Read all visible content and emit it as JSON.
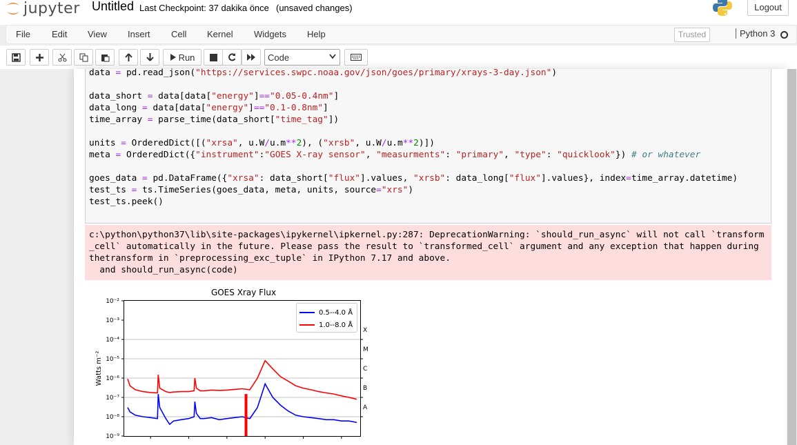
{
  "header": {
    "logo_text": "jupyter",
    "notebook_name": "Untitled",
    "checkpoint": "Last Checkpoint: 37 dakika önce",
    "unsaved": "(unsaved changes)",
    "logout_label": "Logout"
  },
  "menu": {
    "items": [
      "File",
      "Edit",
      "View",
      "Insert",
      "Cell",
      "Kernel",
      "Widgets",
      "Help"
    ],
    "trusted_label": "Trusted",
    "kernel_name": "Python 3"
  },
  "toolbar": {
    "buttons": [
      "save-icon",
      "plus-icon",
      "scissors-icon",
      "copy-icon",
      "paste-icon",
      "arrow-up-icon",
      "arrow-down-icon",
      "run-icon",
      "stop-icon",
      "restart-icon",
      "fast-forward-icon",
      "keyboard-icon"
    ],
    "run_label": "Run",
    "cell_type": "Code"
  },
  "code": {
    "line1": "data = pd.read_json(\"https://services.swpc.noaa.gov/json/goes/primary/xrays-3-day.json\")",
    "line2": "data_short = data[data[\"energy\"]==\"0.05-0.4nm\"]",
    "line3": "data_long = data[data[\"energy\"]==\"0.1-0.8nm\"]",
    "line4": "time_array = parse_time(data_short[\"time_tag\"])",
    "line5": "units = OrderedDict([(\"xrsa\", u.W/u.m**2), (\"xrsb\", u.W/u.m**2)])",
    "line6": "meta = OrderedDict({\"instrument\":\"GOES X-ray sensor\", \"measurments\": \"primary\", \"type\": \"quicklook\"}) # or whatever",
    "line7": "goes_data = pd.DataFrame({\"xrsa\": data_short[\"flux\"].values, \"xrsb\": data_long[\"flux\"].values}, index=time_array.datetime)",
    "line8": "test_ts = ts.TimeSeries(goes_data, meta, units, source=\"xrs\")",
    "line9": "test_ts.peek()"
  },
  "warning": {
    "line1": "c:\\python\\python37\\lib\\site-packages\\ipykernel\\ipkernel.py:287: DeprecationWarning: `should_run_async` will not call `transform",
    "line2": "_cell` automatically in the future. Please pass the result to `transformed_cell` argument and any exception that happen during",
    "line3": "thetransform in `preprocessing_exc_tuple` in IPython 7.17 and above.",
    "line4": "  and should_run_async(code)"
  },
  "chart_data": {
    "type": "line",
    "title": "GOES Xray Flux",
    "ylabel": "Watts m⁻²",
    "yscale": "log",
    "ylim": [
      1e-09,
      0.01
    ],
    "ytick_labels": [
      "10⁻²",
      "10⁻³",
      "10⁻⁴",
      "10⁻⁵",
      "10⁻⁶",
      "10⁻⁷",
      "10⁻⁸",
      "10⁻⁹"
    ],
    "flare_classes": [
      "X",
      "M",
      "C",
      "B",
      "A"
    ],
    "grid": true,
    "legend_position": "top-right",
    "x": [
      0,
      0.03,
      0.1,
      0.2,
      0.3,
      0.39,
      0.4,
      0.42,
      0.5,
      0.55,
      0.6,
      0.7,
      0.8,
      0.87,
      0.88,
      0.9,
      0.95,
      1.0,
      1.1,
      1.2,
      1.3,
      1.4,
      1.5,
      1.6,
      1.7,
      1.8,
      1.9,
      2.0,
      2.1,
      2.2,
      2.3,
      2.4,
      2.5,
      2.6,
      2.7,
      2.8,
      2.9,
      3.0
    ],
    "series": [
      {
        "name": "0.5--4.0 Å",
        "color": "#0000ff",
        "values": [
          3e-08,
          1.8e-08,
          1.2e-08,
          1e-08,
          9e-09,
          8e-09,
          1.5e-07,
          3e-08,
          8e-09,
          4e-09,
          6e-09,
          7e-09,
          8e-09,
          1e-08,
          6e-08,
          1.5e-08,
          8e-09,
          8e-09,
          9e-09,
          7e-09,
          8e-09,
          9e-09,
          1e-08,
          8e-09,
          3e-08,
          5e-07,
          1e-07,
          4e-08,
          2e-08,
          1.2e-08,
          1e-08,
          9e-09,
          8e-09,
          7e-09,
          7e-09,
          6e-09,
          6e-09,
          5e-09
        ]
      },
      {
        "name": "1.0--8.0 Å",
        "color": "#ff0000",
        "values": [
          9e-07,
          4e-07,
          2.5e-07,
          2e-07,
          1.8e-07,
          1.7e-07,
          1.5e-06,
          3e-07,
          2e-07,
          1.8e-07,
          1.9e-07,
          2e-07,
          2e-07,
          2.2e-07,
          1e-06,
          3e-07,
          2.2e-07,
          2.2e-07,
          2.4e-07,
          2.3e-07,
          2.4e-07,
          2.6e-07,
          2.8e-07,
          2.5e-07,
          1e-06,
          8e-06,
          3e-06,
          1.2e-06,
          7e-07,
          4e-07,
          3e-07,
          2.5e-07,
          2e-07,
          1.7e-07,
          1.5e-07,
          1.2e-07,
          1e-07,
          8e-08
        ]
      }
    ]
  }
}
